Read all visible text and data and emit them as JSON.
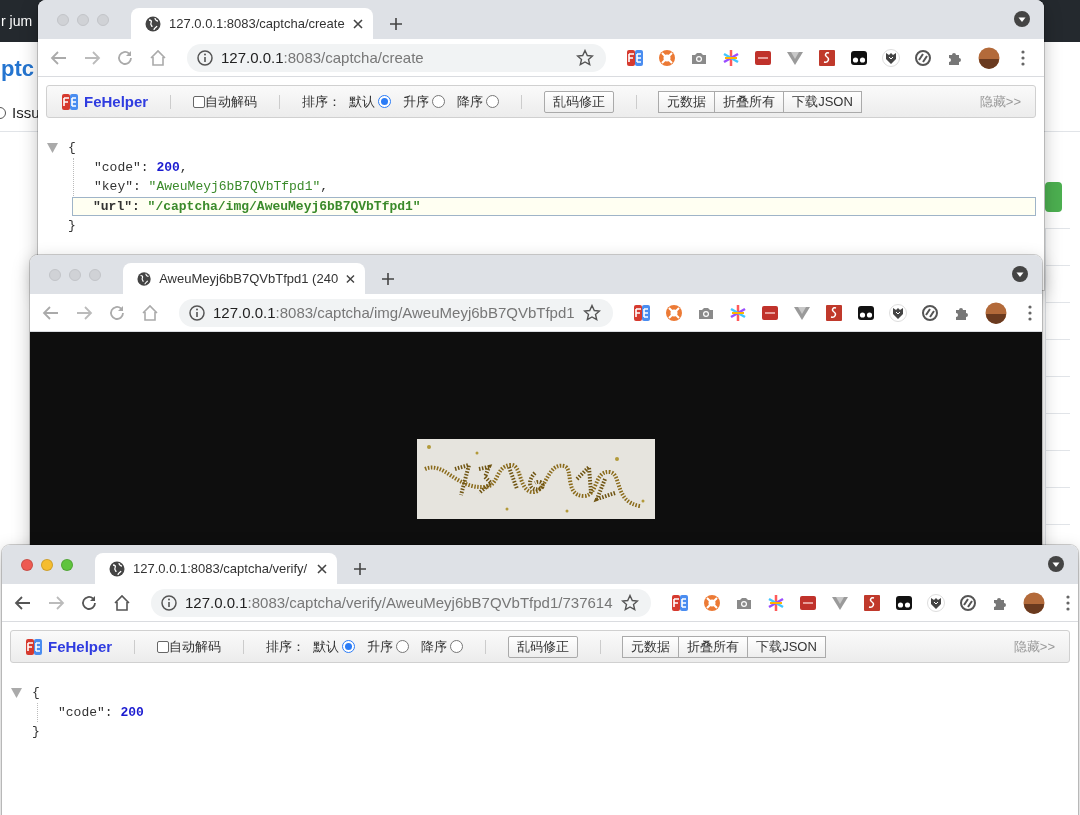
{
  "background_page": {
    "header_text": "r jum",
    "title": "ptc",
    "filter": {
      "label": "Issu",
      "selected": false
    }
  },
  "windows": [
    {
      "kind": "json",
      "active": false,
      "forward_enabled": false,
      "tab_title": "127.0.0.1:8083/captcha/create",
      "url_host": "127.0.0.1",
      "url_path": ":8083/captcha/create",
      "fehelper": {
        "brand": "FeHelper",
        "auto_decode": {
          "label": "自动解码",
          "checked": false
        },
        "sort_label": "排序：",
        "sort_options": [
          {
            "label": "默认",
            "selected": true
          },
          {
            "label": "升序",
            "selected": false
          },
          {
            "label": "降序",
            "selected": false
          }
        ],
        "fix_button": "乱码修正",
        "buttons": [
          "元数据",
          "折叠所有",
          "下载JSON"
        ],
        "hide_link": "隐藏>>"
      },
      "json": {
        "expanded": true,
        "open": "{",
        "close": "}",
        "entries": [
          {
            "key": "\"code\":",
            "value": "200",
            "kind": "number",
            "suffix": ",",
            "highlighted": false
          },
          {
            "key": "\"key\":",
            "value": "\"AweuMeyj6bB7QVbTfpd1\"",
            "kind": "string",
            "suffix": ",",
            "highlighted": false
          },
          {
            "key": "\"url\":",
            "value": "\"/captcha/img/AweuMeyj6bB7QVbTfpd1\"",
            "kind": "string",
            "highlighted": true
          }
        ]
      }
    },
    {
      "kind": "image",
      "active": false,
      "forward_enabled": false,
      "tab_title": "AweuMeyj6bB7QVbTfpd1 (240",
      "url_host": "127.0.0.1",
      "url_path": ":8083/captcha/img/AweuMeyj6bB7QVbTfpd1"
    },
    {
      "kind": "json",
      "active": true,
      "forward_enabled": false,
      "tab_title": "127.0.0.1:8083/captcha/verify/",
      "url_host": "127.0.0.1",
      "url_path": ":8083/captcha/verify/AweuMeyj6bB7QVbTfpd1/737614",
      "fehelper": {
        "brand": "FeHelper",
        "auto_decode": {
          "label": "自动解码",
          "checked": false
        },
        "sort_label": "排序：",
        "sort_options": [
          {
            "label": "默认",
            "selected": true
          },
          {
            "label": "升序",
            "selected": false
          },
          {
            "label": "降序",
            "selected": false
          }
        ],
        "fix_button": "乱码修正",
        "buttons": [
          "元数据",
          "折叠所有",
          "下载JSON"
        ],
        "hide_link": "隐藏>>"
      },
      "json": {
        "expanded": true,
        "open": "{",
        "close": "}",
        "entries": [
          {
            "key": "\"code\":",
            "value": "200",
            "kind": "number",
            "highlighted": false
          }
        ]
      }
    }
  ]
}
